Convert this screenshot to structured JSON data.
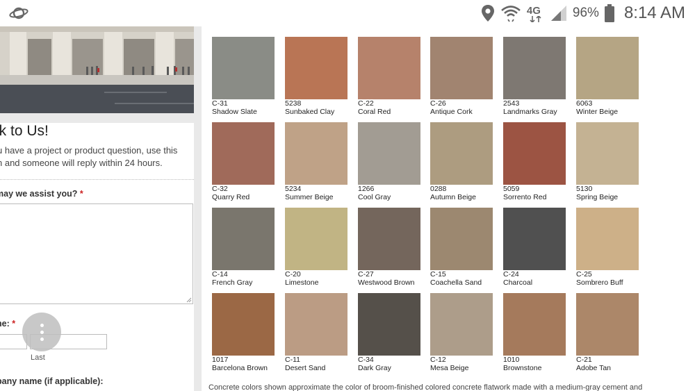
{
  "status_bar": {
    "network": "4G",
    "battery_percent": "96%",
    "time": "8:14 AM",
    "icons": [
      "planet-icon",
      "location-pin-icon",
      "wifi-icon",
      "4g-icon",
      "signal-icon",
      "battery-icon"
    ]
  },
  "form": {
    "title": "lk to Us!",
    "intro_line1": "u have a project or product question, use this",
    "intro_line2": "n and someone will reply within 24 hours.",
    "assist_label": " may we assist you?",
    "required_mark": "*",
    "name_label": "ne:",
    "last_caption": "Last",
    "company_label": "pany name (if applicable):"
  },
  "palette": {
    "swatches": [
      {
        "code": "C-31",
        "name": "Shadow Slate",
        "color": "#8a8c86"
      },
      {
        "code": "5238",
        "name": "Sunbaked Clay",
        "color": "#b97555"
      },
      {
        "code": "C-22",
        "name": "Coral Red",
        "color": "#b6826b"
      },
      {
        "code": "C-26",
        "name": "Antique Cork",
        "color": "#a18470"
      },
      {
        "code": "2543",
        "name": "Landmarks Gray",
        "color": "#7e7872"
      },
      {
        "code": "6063",
        "name": "Winter Beige",
        "color": "#b5a584"
      },
      {
        "code": "C-32",
        "name": "Quarry Red",
        "color": "#a06a5a"
      },
      {
        "code": "5234",
        "name": "Summer Beige",
        "color": "#bfa287"
      },
      {
        "code": "1266",
        "name": "Cool Gray",
        "color": "#a29c93"
      },
      {
        "code": "0288",
        "name": "Autumn Beige",
        "color": "#ad9c80"
      },
      {
        "code": "5059",
        "name": "Sorrento Red",
        "color": "#9c5443"
      },
      {
        "code": "5130",
        "name": "Spring Beige",
        "color": "#c4b293"
      },
      {
        "code": "C-14",
        "name": "French Gray",
        "color": "#7a766d"
      },
      {
        "code": "C-20",
        "name": "Limestone",
        "color": "#c1b484"
      },
      {
        "code": "C-27",
        "name": "Westwood Brown",
        "color": "#74665c"
      },
      {
        "code": "C-15",
        "name": "Coachella Sand",
        "color": "#9c8870"
      },
      {
        "code": "C-24",
        "name": "Charcoal",
        "color": "#505050"
      },
      {
        "code": "C-25",
        "name": "Sombrero Buff",
        "color": "#cdb088"
      },
      {
        "code": "1017",
        "name": "Barcelona Brown",
        "color": "#9b6845"
      },
      {
        "code": "C-11",
        "name": "Desert Sand",
        "color": "#bb9c84"
      },
      {
        "code": "C-34",
        "name": "Dark Gray",
        "color": "#55504a"
      },
      {
        "code": "C-12",
        "name": "Mesa Beige",
        "color": "#ad9d8a"
      },
      {
        "code": "1010",
        "name": "Brownstone",
        "color": "#a57a5c"
      },
      {
        "code": "C-21",
        "name": "Adobe Tan",
        "color": "#ac8769"
      }
    ],
    "footnote": "Concrete colors shown approximate the color of broom-finished colored concrete flatwork made with a medium-gray cement and"
  }
}
